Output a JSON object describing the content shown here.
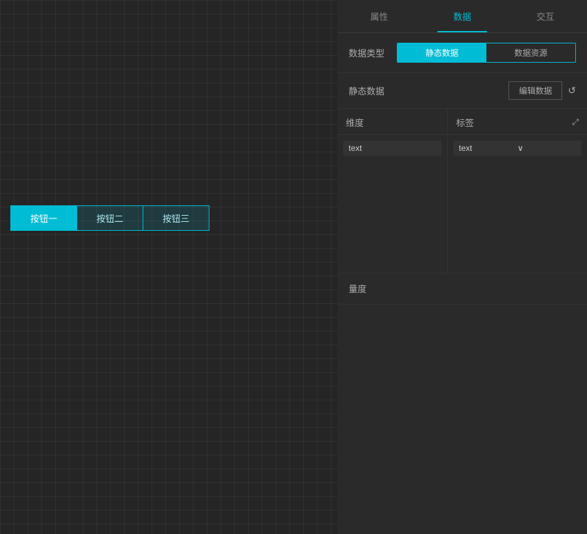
{
  "tabs": {
    "properties": "属性",
    "data": "数据",
    "interaction": "交互",
    "active": "data"
  },
  "dataType": {
    "label": "数据类型",
    "options": [
      {
        "id": "static",
        "label": "静态数据",
        "active": true
      },
      {
        "id": "resource",
        "label": "数据资源",
        "active": false
      }
    ]
  },
  "staticData": {
    "label": "静态数据",
    "editButton": "编辑数据",
    "refreshIcon": "↺"
  },
  "dimension": {
    "label": "维度",
    "item": "text"
  },
  "tag": {
    "label": "标签",
    "externalIcon": "⤢",
    "value": "text",
    "chevron": "∨"
  },
  "measure": {
    "label": "量度"
  },
  "canvas": {
    "buttons": {
      "one": "按钮一",
      "two": "按钮二",
      "three": "按钮三"
    }
  }
}
